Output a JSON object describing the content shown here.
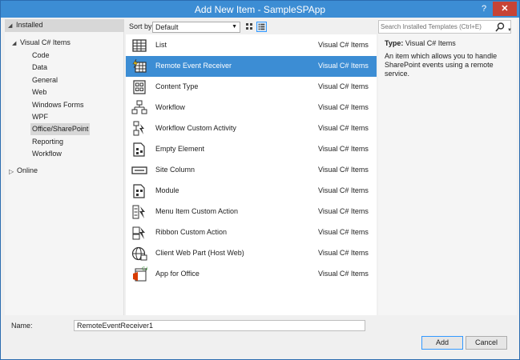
{
  "window": {
    "title": "Add New Item - SampleSPApp",
    "help_glyph": "?",
    "close_glyph": "✕"
  },
  "left_pane": {
    "installed_label": "Installed",
    "visual_csharp_label": "Visual C# Items",
    "items": [
      "Code",
      "Data",
      "General",
      "Web",
      "Windows Forms",
      "WPF",
      "Office/SharePoint",
      "Reporting",
      "Workflow"
    ],
    "selected_item": "Office/SharePoint",
    "online_label": "Online"
  },
  "toolbar": {
    "sort_label": "Sort by:",
    "sort_value": "Default"
  },
  "templates": [
    {
      "name": "List",
      "category": "Visual C# Items",
      "icon": "list-icon"
    },
    {
      "name": "Remote Event Receiver",
      "category": "Visual C# Items",
      "icon": "remote-event-receiver-icon",
      "selected": true
    },
    {
      "name": "Content Type",
      "category": "Visual C# Items",
      "icon": "content-type-icon"
    },
    {
      "name": "Workflow",
      "category": "Visual C# Items",
      "icon": "workflow-icon"
    },
    {
      "name": "Workflow Custom Activity",
      "category": "Visual C# Items",
      "icon": "workflow-activity-icon"
    },
    {
      "name": "Empty Element",
      "category": "Visual C# Items",
      "icon": "empty-element-icon"
    },
    {
      "name": "Site Column",
      "category": "Visual C# Items",
      "icon": "site-column-icon"
    },
    {
      "name": "Module",
      "category": "Visual C# Items",
      "icon": "module-icon"
    },
    {
      "name": "Menu Item Custom Action",
      "category": "Visual C# Items",
      "icon": "menu-action-icon"
    },
    {
      "name": "Ribbon Custom Action",
      "category": "Visual C# Items",
      "icon": "ribbon-action-icon"
    },
    {
      "name": "Client Web Part (Host Web)",
      "category": "Visual C# Items",
      "icon": "web-part-icon"
    },
    {
      "name": "App for Office",
      "category": "Visual C# Items",
      "icon": "app-for-office-icon"
    }
  ],
  "details": {
    "search_placeholder": "Search Installed Templates (Ctrl+E)",
    "type_label": "Type:",
    "type_value": "Visual C# Items",
    "description": "An item which allows you to handle SharePoint events using a remote service."
  },
  "footer": {
    "name_label": "Name:",
    "name_value": "RemoteEventReceiver1",
    "add_label": "Add",
    "cancel_label": "Cancel"
  },
  "colors": {
    "titlebar": "#3c8dd4",
    "selection": "#3c8dd4",
    "close_button": "#c74336"
  }
}
